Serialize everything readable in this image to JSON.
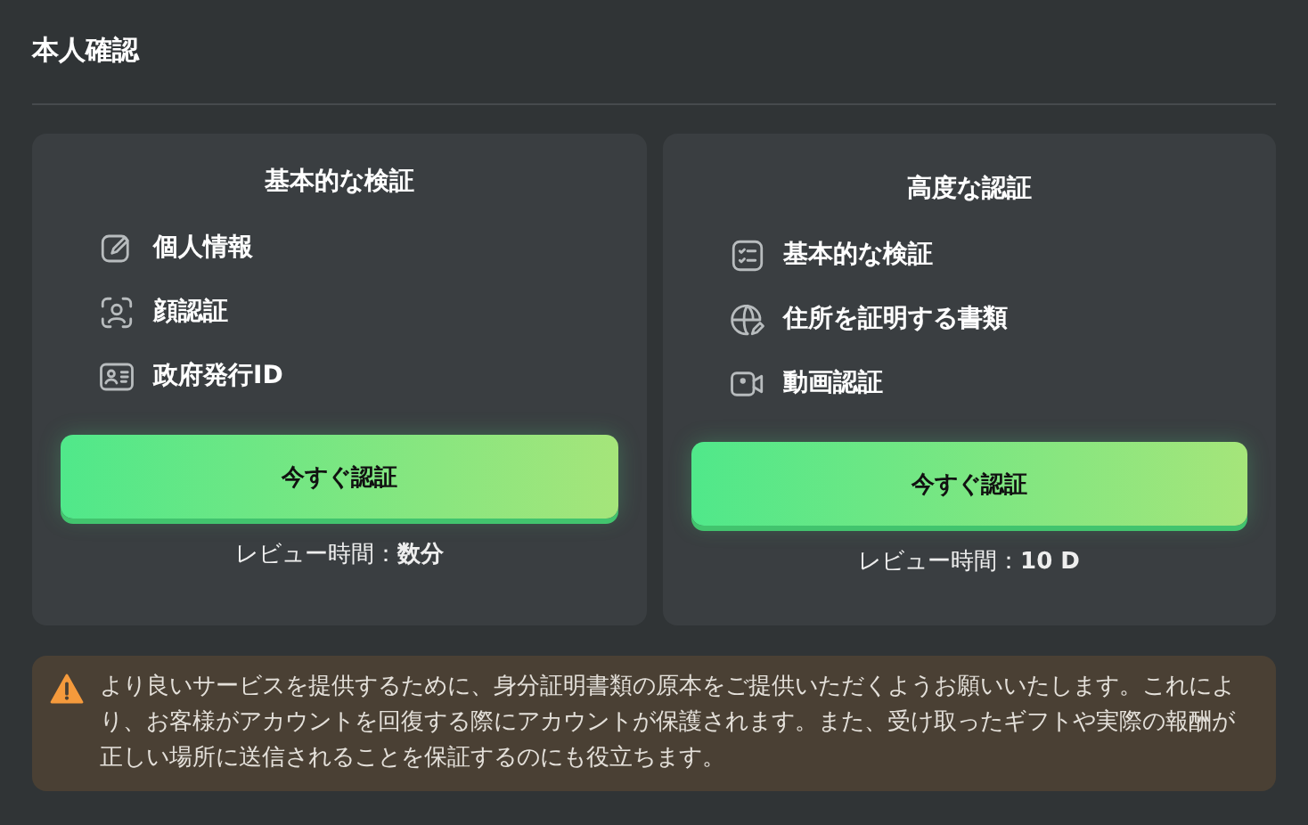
{
  "title": "本人確認",
  "cards": [
    {
      "title": "基本的な検証",
      "items": [
        {
          "kind": "pencil",
          "label": "個人情報"
        },
        {
          "kind": "face",
          "label": "顔認証"
        },
        {
          "kind": "idcard",
          "label": "政府発行ID"
        }
      ],
      "button": "今すぐ認証",
      "review": "レビュー時間：**数分**"
    },
    {
      "title": "高度な認証",
      "items": [
        {
          "kind": "checklist",
          "label": "基本的な検証"
        },
        {
          "kind": "globe",
          "label": "住所を証明する書類"
        },
        {
          "kind": "video",
          "label": "動画認証"
        }
      ],
      "button": "今すぐ認証",
      "review": "レビュー時間：**10 D**"
    }
  ],
  "notice": {
    "kind": "warning",
    "text": "より良いサービスを提供するために、身分証明書類の原本をご提供いただくようお願いいたします。これにより、お客様がアカウントを回復する際にアカウントが保護されます。また、受け取ったギフトや実際の報酬が正しい場所に送信されることを保証するのにも役立ちます。"
  }
}
